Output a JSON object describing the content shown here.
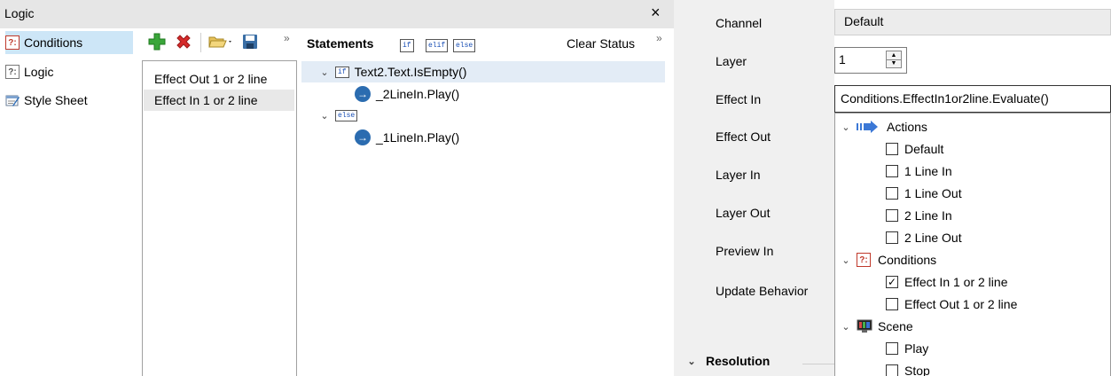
{
  "logic_panel": {
    "title": "Logic",
    "close_glyph": "×",
    "nav": [
      {
        "label": "Conditions",
        "icon": "conditions-icon",
        "icon_text": "?:",
        "selected": true
      },
      {
        "label": "Logic",
        "icon": "logic-icon",
        "icon_text": "?:",
        "selected": false
      },
      {
        "label": "Style Sheet",
        "icon": "style-sheet-icon",
        "icon_text": "",
        "selected": false
      }
    ],
    "toolbar": {
      "add_icon": "plus-icon",
      "delete_icon": "delete-x-icon",
      "open_icon": "folder-open-icon",
      "save_icon": "save-disk-icon",
      "overflow_glyph": "»"
    },
    "conditions": [
      {
        "label": "Effect Out 1 or 2 line",
        "selected": false
      },
      {
        "label": "Effect In 1 or 2 line",
        "selected": true
      }
    ],
    "statements": {
      "header": "Statements",
      "kw_if": "if",
      "kw_elif": "elif",
      "kw_else": "else",
      "clear_status": "Clear Status",
      "overflow_glyph": "»",
      "tree": {
        "if_kw": "if",
        "if_expr": "Text2.Text.IsEmpty()",
        "if_action": "_2LineIn.Play()",
        "else_kw": "else",
        "else_action": "_1LineIn.Play()"
      }
    }
  },
  "properties": {
    "labels": {
      "channel": "Channel",
      "layer": "Layer",
      "effect_in": "Effect In",
      "effect_out": "Effect Out",
      "layer_in": "Layer In",
      "layer_out": "Layer Out",
      "preview_in": "Preview In",
      "update_behavior": "Update Behavior"
    },
    "channel_value": "Default",
    "layer_value": "1",
    "effect_in_value": "Conditions.EffectIn1or2line.Evaluate()",
    "dropdown": {
      "actions_group": "Actions",
      "actions": [
        {
          "label": "Default",
          "checked": false
        },
        {
          "label": "1 Line In",
          "checked": false
        },
        {
          "label": "1 Line Out",
          "checked": false
        },
        {
          "label": "2 Line In",
          "checked": false
        },
        {
          "label": "2 Line Out",
          "checked": false
        }
      ],
      "conditions_group": "Conditions",
      "conditions": [
        {
          "label": "Effect In 1 or 2 line",
          "checked": true
        },
        {
          "label": "Effect Out 1 or 2 line",
          "checked": false
        }
      ],
      "scene_group": "Scene",
      "scene": [
        {
          "label": "Play",
          "checked": false
        },
        {
          "label": "Stop",
          "checked": false
        }
      ]
    },
    "resolution_label": "Resolution",
    "colors": {
      "selection_blue": "#cde6f7",
      "tree_selection": "#e3ecf6",
      "add_green": "#3aa63a",
      "delete_red": "#d62b2b",
      "arrow_blue": "#2b6cb0"
    }
  }
}
